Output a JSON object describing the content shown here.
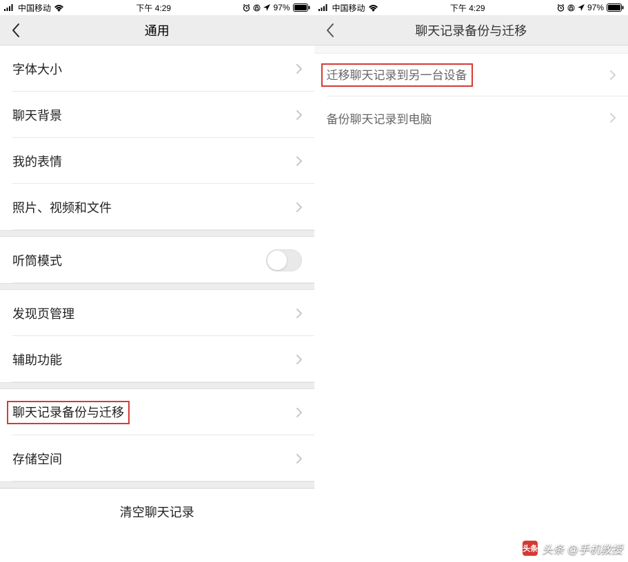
{
  "status": {
    "carrier": "中国移动",
    "time": "下午 4:29",
    "battery": "97%"
  },
  "left": {
    "title": "通用",
    "groups": [
      {
        "items": [
          {
            "label": "字体大小",
            "id": "font-size"
          },
          {
            "label": "聊天背景",
            "id": "chat-bg"
          },
          {
            "label": "我的表情",
            "id": "stickers"
          },
          {
            "label": "照片、视频和文件",
            "id": "media-files"
          }
        ]
      },
      {
        "items": [
          {
            "label": "听筒模式",
            "id": "earpiece-mode",
            "toggle": true
          }
        ]
      },
      {
        "items": [
          {
            "label": "发现页管理",
            "id": "discover-manage"
          },
          {
            "label": "辅助功能",
            "id": "accessibility"
          }
        ]
      },
      {
        "items": [
          {
            "label": "聊天记录备份与迁移",
            "id": "chat-backup-migrate",
            "highlight": true
          },
          {
            "label": "存储空间",
            "id": "storage"
          }
        ]
      }
    ],
    "clear": "清空聊天记录"
  },
  "right": {
    "title": "聊天记录备份与迁移",
    "items": [
      {
        "label": "迁移聊天记录到另一台设备",
        "id": "migrate-to-device",
        "highlight": true
      },
      {
        "label": "备份聊天记录到电脑",
        "id": "backup-to-pc"
      }
    ]
  },
  "watermark": {
    "logo": "头条",
    "text": "头条 @手机教授"
  }
}
